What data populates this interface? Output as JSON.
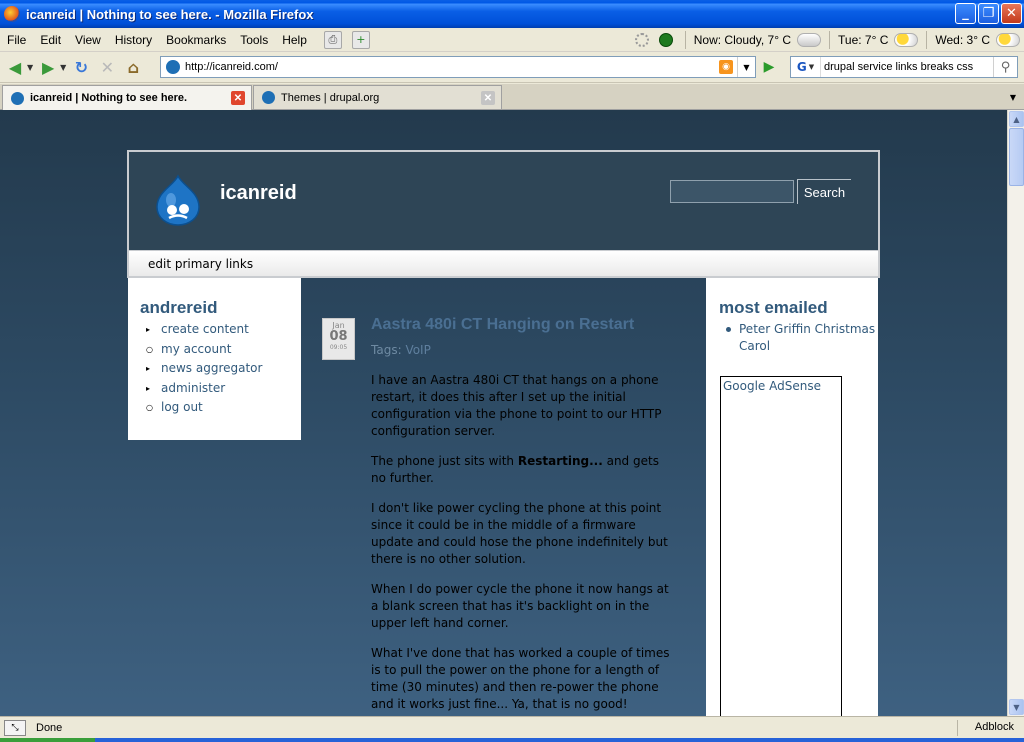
{
  "window": {
    "title": "icanreid | Nothing to see here. - Mozilla Firefox"
  },
  "menubar": {
    "items": [
      "File",
      "Edit",
      "View",
      "History",
      "Bookmarks",
      "Tools",
      "Help"
    ],
    "weather": {
      "now": "Now: Cloudy, 7° C",
      "tue": "Tue: 7° C",
      "wed": "Wed: 3° C"
    }
  },
  "navbar": {
    "url": "http://icanreid.com/",
    "search_value": "drupal service links breaks css",
    "search_engine": "G"
  },
  "tabs": [
    {
      "label": "icanreid | Nothing to see here.",
      "active": true
    },
    {
      "label": "Themes | drupal.org",
      "active": false
    }
  ],
  "site": {
    "name": "icanreid",
    "search_button": "Search",
    "primary_links": "edit primary links"
  },
  "left_sidebar": {
    "title": "andrereid",
    "items": [
      {
        "label": "create content",
        "bullet": "▸"
      },
      {
        "label": "my account",
        "bullet": "○"
      },
      {
        "label": "news aggregator",
        "bullet": "▸"
      },
      {
        "label": "administer",
        "bullet": "▸"
      },
      {
        "label": "log out",
        "bullet": "○"
      }
    ]
  },
  "post": {
    "date": {
      "month": "Jan",
      "day": "08",
      "time": "09:05"
    },
    "title": "Aastra 480i CT Hanging on Restart",
    "tags_label": "Tags:",
    "tag": "VoIP",
    "paragraphs": {
      "p1": "I have an Aastra 480i CT that hangs on a phone restart, it does this after I set up the initial configuration via the phone to point to our HTTP configuration server.",
      "p2_before": "The phone just sits with ",
      "p2_bold": "Restarting...",
      "p2_after": " and gets no further.",
      "p3": "I don't like power cycling the phone at this point since it could be in the middle of a firmware update and could hose the phone indefinitely but there is no other solution.",
      "p4": "When I do power cycle the phone it now hangs at a blank screen that has it's backlight on in the upper left hand corner.",
      "p5": "What I've done that has worked a couple of times is to pull the power on the phone for a length of time (30 minutes) and then re-power the phone and it works just fine... Ya, that is no good!"
    }
  },
  "right_sidebar": {
    "title": "most emailed",
    "items": [
      "Peter Griffin Christmas Carol"
    ],
    "adsense": "Google AdSense"
  },
  "statusbar": {
    "text": "Done",
    "addon": "Adblock"
  },
  "colors": {
    "accent": "#325a7c",
    "header_bg": "#2e4556"
  }
}
